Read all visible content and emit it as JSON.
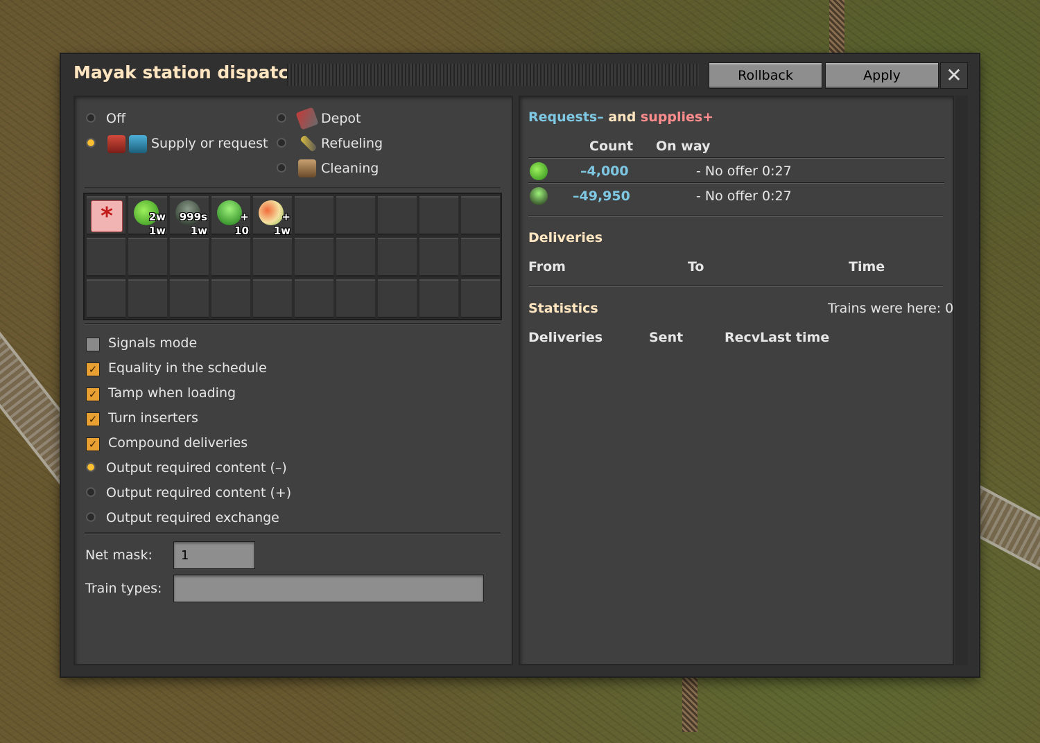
{
  "window": {
    "title": "Mayak station dispatcher",
    "rollback_label": "Rollback",
    "apply_label": "Apply",
    "close_glyph": "✕"
  },
  "mode": {
    "left": [
      {
        "label": "Off",
        "selected": false
      },
      {
        "label": "Supply or request",
        "selected": true
      }
    ],
    "right": [
      {
        "label": "Depot",
        "selected": false,
        "icon": "locomotive-icon"
      },
      {
        "label": "Refueling",
        "selected": false,
        "icon": "fuel-icon"
      },
      {
        "label": "Cleaning",
        "selected": false,
        "icon": "cleaning-chest-icon"
      }
    ]
  },
  "slots": [
    {
      "icon": "asterisk-icon",
      "top": "",
      "bottom": ""
    },
    {
      "icon": "green-ore-icon",
      "top": "2w",
      "bottom": "1w"
    },
    {
      "icon": "barrel-dark-icon",
      "top": "999s",
      "bottom": "1w"
    },
    {
      "icon": "barrel-green-icon",
      "top": "+",
      "bottom": "10"
    },
    {
      "icon": "mixed-ore-icon",
      "top": "+",
      "bottom": "1w"
    }
  ],
  "options": {
    "signals_mode": "Signals mode",
    "equality": "Equality in the schedule",
    "tamp": "Tamp when loading",
    "turn": "Turn inserters",
    "compound": "Compound deliveries",
    "out_minus": "Output required content (–)",
    "out_plus": "Output required content (+)",
    "out_exchange": "Output required exchange"
  },
  "net_mask": {
    "label": "Net mask:",
    "value": "1"
  },
  "train_types": {
    "label": "Train types:",
    "value": ""
  },
  "requests": {
    "title_part1": "Requests–",
    "title_part2": " and ",
    "title_part3": "supplies+",
    "col_count": "Count",
    "col_onway": "On way",
    "rows": [
      {
        "icon": "green-ore-icon",
        "count": "–4,000",
        "onway": "- No offer 0:27"
      },
      {
        "icon": "barrel-green-icon",
        "count": "–49,950",
        "onway": "- No offer 0:27"
      }
    ]
  },
  "deliveries": {
    "title": "Deliveries",
    "col_from": "From",
    "col_to": "To",
    "col_time": "Time"
  },
  "statistics": {
    "title": "Statistics",
    "trains_here": "Trains were here: 0",
    "col_deliveries": "Deliveries",
    "col_sent": "Sent",
    "col_recv": "Recv",
    "col_last": "Last time"
  },
  "colors": {
    "accent_blue": "#7ec8e3",
    "accent_red": "#ff8d8d",
    "orange": "#e8a032",
    "title": "#ffe6c0"
  }
}
